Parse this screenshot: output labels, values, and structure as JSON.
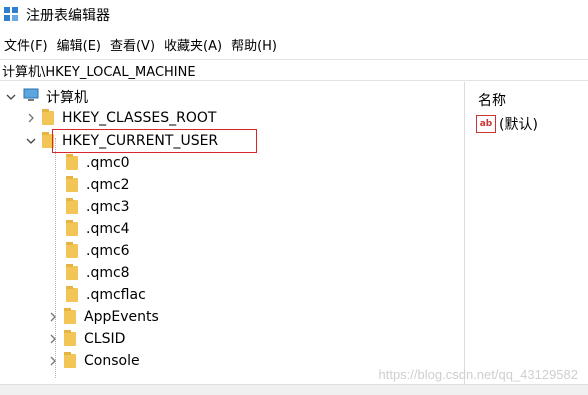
{
  "window": {
    "title": "注册表编辑器",
    "icon": "regedit-icon"
  },
  "menu": [
    "文件(F)",
    "编辑(E)",
    "查看(V)",
    "收藏夹(A)",
    "帮助(H)"
  ],
  "address": "计算机\\HKEY_LOCAL_MACHINE",
  "tree": {
    "root": "计算机",
    "items": [
      {
        "label": "HKEY_CLASSES_ROOT",
        "expander": "collapsed"
      },
      {
        "label": "HKEY_CURRENT_USER",
        "expander": "expanded",
        "highlighted": true
      },
      {
        "label": ".qmc0",
        "expander": "none"
      },
      {
        "label": ".qmc2",
        "expander": "none"
      },
      {
        "label": ".qmc3",
        "expander": "none"
      },
      {
        "label": ".qmc4",
        "expander": "none"
      },
      {
        "label": ".qmc6",
        "expander": "none"
      },
      {
        "label": ".qmc8",
        "expander": "none"
      },
      {
        "label": ".qmcflac",
        "expander": "none"
      },
      {
        "label": "AppEvents",
        "expander": "collapsed"
      },
      {
        "label": "CLSID",
        "expander": "collapsed"
      },
      {
        "label": "Console",
        "expander": "collapsed"
      }
    ]
  },
  "values_pane": {
    "column_name": "名称",
    "rows": [
      {
        "type_icon": "ab-icon",
        "name": "(默认)"
      }
    ]
  },
  "watermark": "https://blog.csdn.net/qq_43129582",
  "colors": {
    "highlight_border": "#d9262a",
    "folder": "#f2c556",
    "accent": "#2f7fd1"
  }
}
